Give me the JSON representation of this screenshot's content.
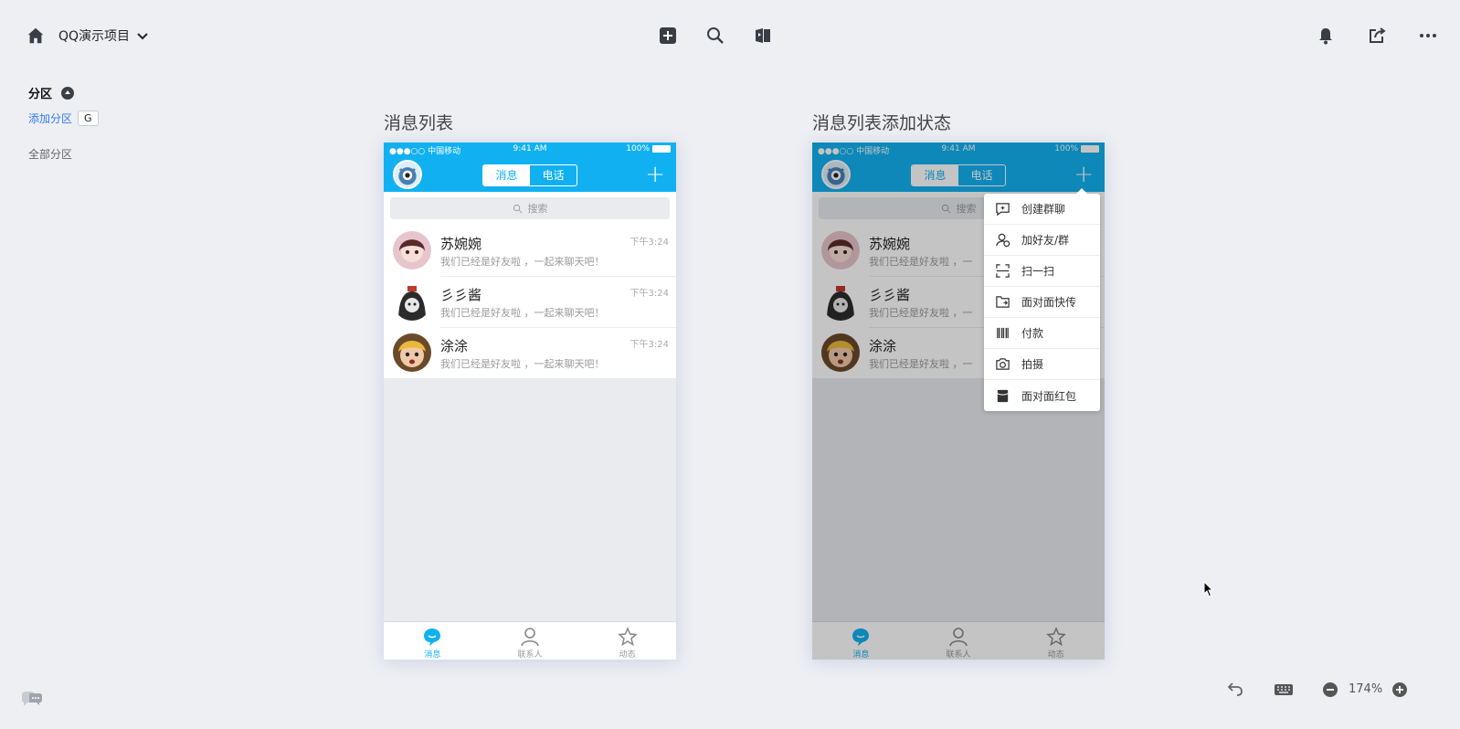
{
  "toolbar": {
    "project_title": "QQ演示项目",
    "left_icons": [
      "home-icon",
      "chevron-down-icon"
    ],
    "center_icons": [
      "add-square-icon",
      "search-icon",
      "flip-card-icon"
    ],
    "right_icons": [
      "bell-icon",
      "share-icon",
      "more-icon"
    ]
  },
  "sections_panel": {
    "title": "分区",
    "add_link": "添加分区",
    "add_shortcut": "G",
    "all_sections": "全部分区"
  },
  "boards": [
    {
      "label": "消息列表",
      "status": {
        "signal": "●●●○○ 中国移动",
        "time": "9:41 AM",
        "battery": "100%"
      },
      "tabs": [
        "消息",
        "电话"
      ],
      "search_placeholder": "搜索",
      "chats": [
        {
          "name": "苏婉婉",
          "message": "我们已经是好友啦 ，一起来聊天吧！",
          "time": "下午3:24"
        },
        {
          "name": "彡彡酱",
          "message": "我们已经是好友啦 ，一起来聊天吧！",
          "time": "下午3:24"
        },
        {
          "name": "涂涂",
          "message": "我们已经是好友啦 ，一起来聊天吧！",
          "time": "下午3:24"
        }
      ],
      "tabbar": [
        "消息",
        "联系人",
        "动态"
      ]
    },
    {
      "label": "消息列表添加状态",
      "status": {
        "signal": "●●●○○ 中国移动",
        "time": "9:41 AM",
        "battery": "100%"
      },
      "tabs": [
        "消息",
        "电话"
      ],
      "search_placeholder": "搜索",
      "chats": [
        {
          "name": "苏婉婉",
          "message": "我们已经是好友啦 ，一",
          "time": ""
        },
        {
          "name": "彡彡酱",
          "message": "我们已经是好友啦 ，一",
          "time": ""
        },
        {
          "name": "涂涂",
          "message": "我们已经是好友啦 ，一",
          "time": ""
        }
      ],
      "tabbar": [
        "消息",
        "联系人",
        "动态"
      ],
      "menu": [
        "创建群聊",
        "加好友/群",
        "扫一扫",
        "面对面快传",
        "付款",
        "拍摄",
        "面对面红包"
      ]
    }
  ],
  "bottombar": {
    "zoom": "174%",
    "icons": [
      "feedback-icon",
      "undo-icon",
      "keyboard-icon",
      "zoom-out-icon",
      "zoom-in-icon"
    ]
  },
  "colors": {
    "qq_blue": "#11b1f1",
    "link_blue": "#2f7cf6",
    "canvas": "#eeeff3"
  }
}
